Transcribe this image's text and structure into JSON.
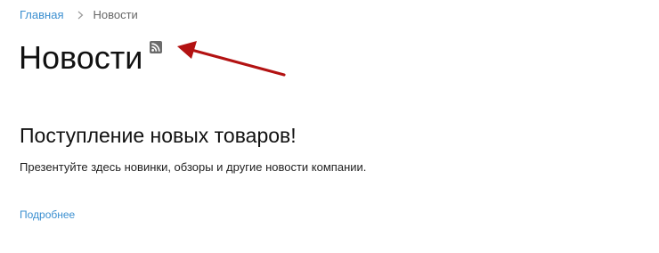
{
  "breadcrumb": {
    "home_label": "Главная",
    "current_label": "Новости"
  },
  "page": {
    "title": "Новости"
  },
  "news": {
    "title": "Поступление новых товаров!",
    "description": "Презентуйте здесь новинки, обзоры и другие новости компании.",
    "more_label": "Подробнее"
  },
  "icons": {
    "breadcrumb_separator": "chevron-right-icon",
    "rss": "rss-icon",
    "annotation": "arrow-icon"
  },
  "colors": {
    "link": "#3b8fd0",
    "arrow": "#b31212",
    "rss_badge": "#6b6b6b"
  }
}
